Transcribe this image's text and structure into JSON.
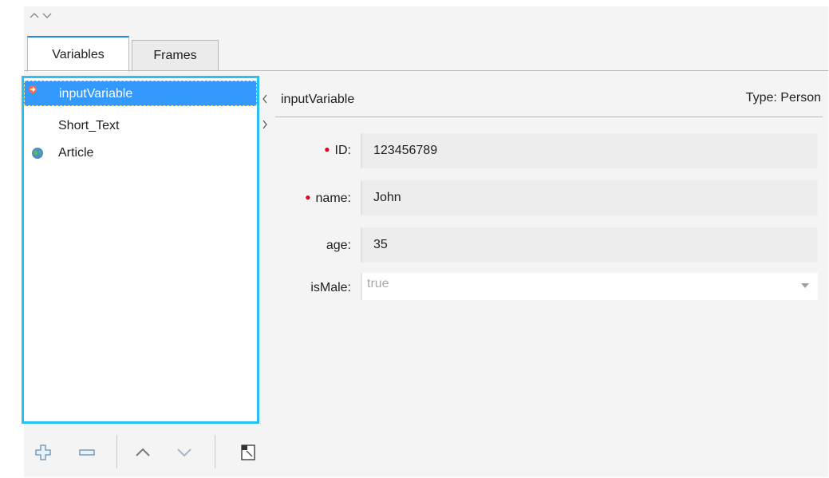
{
  "tabs": [
    {
      "label": "Variables",
      "active": true
    },
    {
      "label": "Frames",
      "active": false
    }
  ],
  "variables": [
    {
      "label": "inputVariable",
      "icon": "input-arrow-icon",
      "selected": true
    },
    {
      "label": "Short_Text",
      "icon": "",
      "selected": false
    },
    {
      "label": "Article",
      "icon": "globe-icon",
      "selected": false
    }
  ],
  "detail": {
    "name": "inputVariable",
    "type_label": "Type: Person",
    "fields": [
      {
        "label": "ID:",
        "required": true,
        "value": "123456789"
      },
      {
        "label": "name:",
        "required": true,
        "value": "John"
      },
      {
        "label": "age:",
        "required": false,
        "value": "35"
      },
      {
        "label": "isMale:",
        "required": false,
        "value": "true",
        "kind": "select"
      }
    ]
  },
  "toolbar": [
    "add-icon",
    "remove-icon",
    "move-up-icon",
    "move-down-icon",
    "edit-icon"
  ],
  "colors": {
    "selection": "#3399ff",
    "list_border": "#29c2f0",
    "required": "#e0001a",
    "active_tab": "#1f8ad8"
  }
}
